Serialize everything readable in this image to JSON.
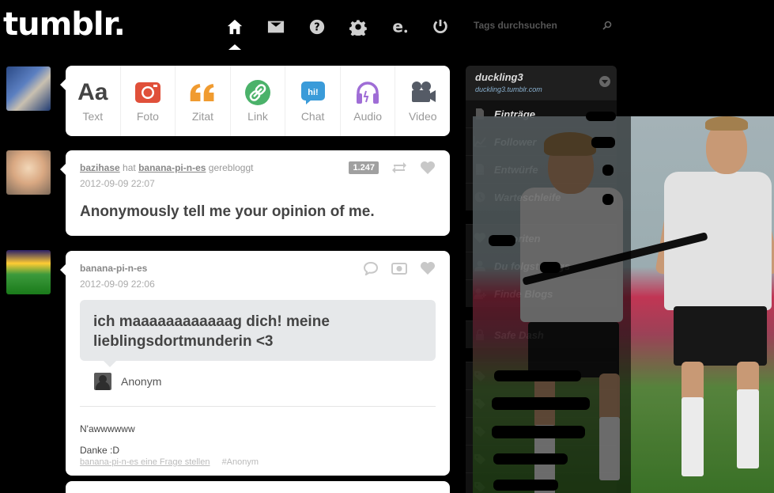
{
  "header": {
    "logo": "tumblr.",
    "nav": [
      {
        "name": "home-icon",
        "active": true
      },
      {
        "name": "mail-icon",
        "active": false
      },
      {
        "name": "help-icon",
        "active": false
      },
      {
        "name": "gear-icon",
        "active": false
      },
      {
        "name": "e-icon",
        "active": false
      },
      {
        "name": "power-icon",
        "active": false
      }
    ],
    "search_placeholder": "Tags durchsuchen"
  },
  "compose": [
    {
      "label": "Text",
      "icon": "text-icon"
    },
    {
      "label": "Foto",
      "icon": "camera-icon"
    },
    {
      "label": "Zitat",
      "icon": "quote-icon"
    },
    {
      "label": "Link",
      "icon": "link-icon"
    },
    {
      "label": "Chat",
      "icon": "chat-icon"
    },
    {
      "label": "Audio",
      "icon": "headphones-icon"
    },
    {
      "label": "Video",
      "icon": "video-camera-icon"
    }
  ],
  "compose_text_glyph": "Aa",
  "compose_chat_glyph": "hi!",
  "posts": [
    {
      "reblogger": "bazihase",
      "reblog_word": "hat",
      "source": "banana-pi-n-es",
      "reblog_suffix": "gerebloggt",
      "date": "2012-09-09 22:07",
      "notes": "1.247",
      "title": "Anonymously tell me your opinion of me."
    },
    {
      "author": "banana-pi-n-es",
      "date": "2012-09-09 22:06",
      "question": "ich maaaaaaaaaaaag dich! meine lieblingsdortmunderin <3",
      "asker": "Anonym",
      "answer_lines": [
        "N'awwwwww",
        "Danke :D"
      ],
      "ask_link": "banana-pi-n-es eine Frage stellen",
      "tag": "#Anonym"
    }
  ],
  "sidebar": {
    "blog_name": "duckling3",
    "blog_url": "duckling3.tumblr.com",
    "items": [
      {
        "label": "Einträge",
        "icon": "document-icon"
      },
      {
        "label": "Follower",
        "icon": "chart-icon"
      },
      {
        "label": "Entwürfe",
        "icon": "document-icon"
      },
      {
        "label": "Warteschleife",
        "icon": "clock-icon"
      }
    ],
    "items2": [
      {
        "label": "Favoriten",
        "icon": "heart-icon"
      },
      {
        "label": "Du folgst Blogs",
        "icon": "person-icon"
      },
      {
        "label": "Finde Blogs",
        "icon": "person-add-icon"
      }
    ],
    "safe_dash": "Safe Dash"
  },
  "colors": {
    "background": "#000000",
    "card": "#ffffff",
    "foto": "#e0503a",
    "zitat": "#f09b30",
    "link": "#4bb26a",
    "chat": "#3a9bd9",
    "audio": "#9f6dd6",
    "video": "#555b66"
  }
}
